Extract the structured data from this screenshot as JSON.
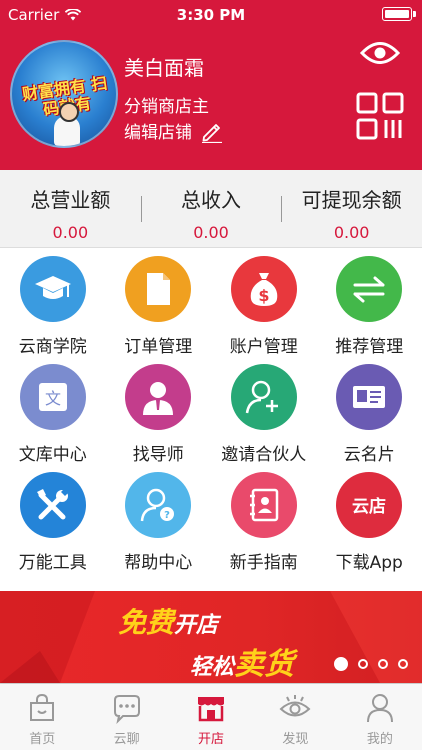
{
  "status_bar": {
    "carrier": "Carrier",
    "time": "3:30 PM"
  },
  "profile": {
    "avatar_text": "财富拥有 扫码就有",
    "shop_name": "美白面霜",
    "role": "分销商店主",
    "edit_label": "编辑店铺"
  },
  "stats": [
    {
      "label": "总营业额",
      "value": "0.00"
    },
    {
      "label": "总收入",
      "value": "0.00"
    },
    {
      "label": "可提现余额",
      "value": "0.00"
    }
  ],
  "menu": [
    {
      "label": "云商学院",
      "icon": "graduation-cap-icon",
      "color": "#3a9be0"
    },
    {
      "label": "订单管理",
      "icon": "document-icon",
      "color": "#f0a020"
    },
    {
      "label": "账户管理",
      "icon": "money-bag-icon",
      "color": "#e8383d"
    },
    {
      "label": "推荐管理",
      "icon": "swap-arrows-icon",
      "color": "#43b84a"
    },
    {
      "label": "文库中心",
      "icon": "translate-icon",
      "color": "#7b8ccf"
    },
    {
      "label": "找导师",
      "icon": "mentor-icon",
      "color": "#c33d8c"
    },
    {
      "label": "邀请合伙人",
      "icon": "add-user-icon",
      "color": "#27a876"
    },
    {
      "label": "云名片",
      "icon": "id-card-icon",
      "color": "#6a5bb3"
    },
    {
      "label": "万能工具",
      "icon": "tools-icon",
      "color": "#2484d8"
    },
    {
      "label": "帮助中心",
      "icon": "help-user-icon",
      "color": "#52b6ea"
    },
    {
      "label": "新手指南",
      "icon": "contacts-book-icon",
      "color": "#e94a6b"
    },
    {
      "label": "下载App",
      "icon": "cloud-store-icon",
      "color": "#de2c3e",
      "icon_text": "云店"
    }
  ],
  "banner": {
    "free": "免费",
    "open_store": "开店",
    "easy": "轻松",
    "sell": "卖货",
    "slide_count": 4,
    "active_slide": 1
  },
  "tabbar": [
    {
      "label": "首页",
      "icon": "shopping-bag-icon"
    },
    {
      "label": "云聊",
      "icon": "chat-bubble-icon"
    },
    {
      "label": "开店",
      "icon": "storefront-icon",
      "active": true
    },
    {
      "label": "发现",
      "icon": "eye-icon"
    },
    {
      "label": "我的",
      "icon": "person-icon"
    }
  ],
  "colors": {
    "primary": "#d6183c",
    "banner_highlight": "#ffd21a"
  }
}
